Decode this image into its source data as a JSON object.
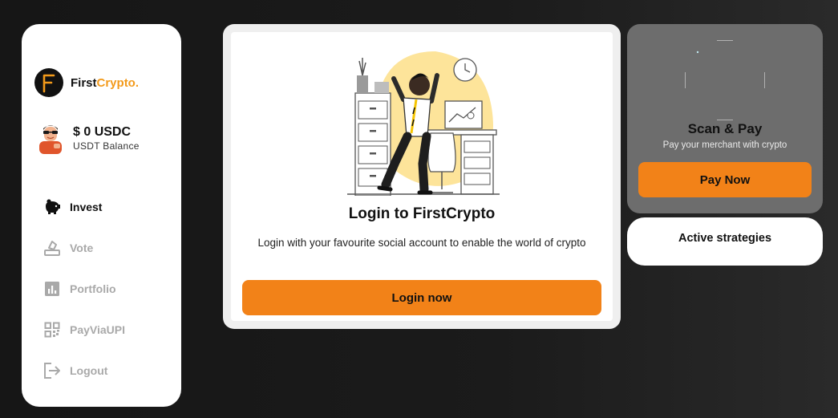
{
  "brand": {
    "name_main": "First",
    "name_accent": "Crypto.",
    "logo_letter": "F"
  },
  "wallet": {
    "balance": "$ 0 USDC",
    "balance_label": "USDT Balance"
  },
  "nav": {
    "items": [
      {
        "label": "Invest",
        "icon": "piggy-bank-icon",
        "active": true
      },
      {
        "label": "Vote",
        "icon": "vote-icon",
        "active": false
      },
      {
        "label": "Portfolio",
        "icon": "chart-bar-icon",
        "active": false
      },
      {
        "label": "PayViaUPI",
        "icon": "qr-code-icon",
        "active": false
      },
      {
        "label": "Logout",
        "icon": "logout-icon",
        "active": false
      }
    ]
  },
  "login": {
    "title": "Login to FirstCrypto",
    "description": "Login with your favourite social account to enable the world of crypto",
    "button_label": "Login now"
  },
  "scan": {
    "title": "Scan & Pay",
    "subtitle": "Pay your merchant with crypto",
    "button_label": "Pay Now"
  },
  "strategies": {
    "title": "Active strategies"
  },
  "colors": {
    "accent": "#f28218",
    "brand_accent": "#f39a1a",
    "card_gray": "#6d6d6d",
    "nav_inactive": "#a9a9a9"
  }
}
